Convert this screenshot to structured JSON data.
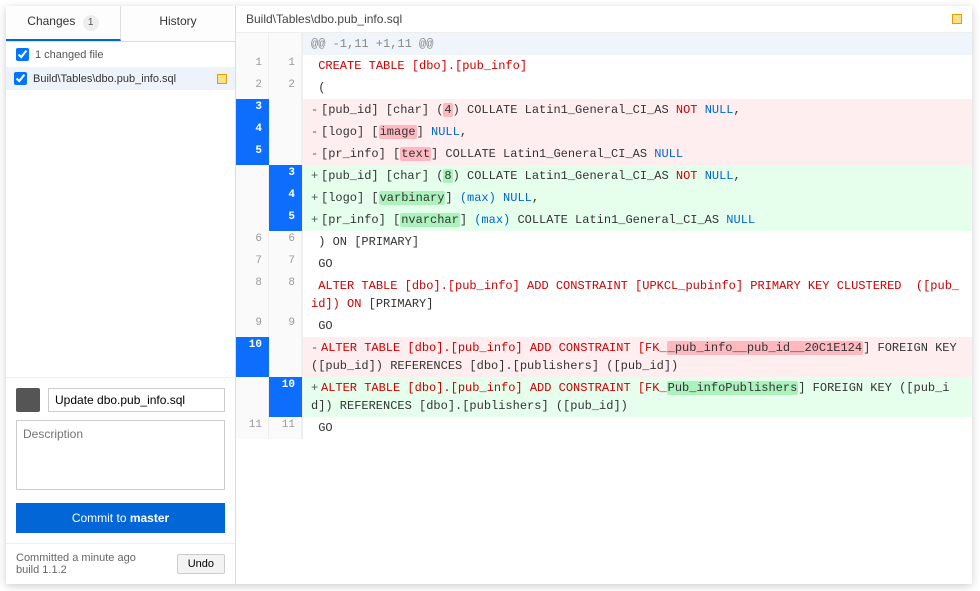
{
  "tabs": {
    "changes": "Changes",
    "changes_count": "1",
    "history": "History"
  },
  "file_header": "1 changed file",
  "files": [
    {
      "name": "Build\\Tables\\dbo.pub_info.sql"
    }
  ],
  "file_path": "Build\\Tables\\dbo.pub_info.sql",
  "commit": {
    "subject": "Update dbo.pub_info.sql",
    "desc_placeholder": "Description",
    "button_prefix": "Commit to ",
    "button_branch": "master",
    "committed_line1": "Committed a minute ago",
    "committed_line2": "build 1.1.2",
    "undo": "Undo"
  },
  "diff": {
    "hunk": "@@ -1,11 +1,11 @@",
    "l1": " CREATE TABLE [dbo].[pub_info]",
    "l2": " (",
    "l3_a": "[pub_id] [char] (",
    "l3_b": "4",
    "l3_c": ") COLLATE Latin1_General_CI_AS ",
    "l4_a": "[logo] [",
    "l4_b": "image",
    "l4_c": "] ",
    "l5_a": "[pr_info] [",
    "l5_b": "text",
    "l5_c": "] COLLATE Latin1_General_CI_AS ",
    "l3p_a": "[pub_id] [char] (",
    "l3p_b": "8",
    "l3p_c": ") COLLATE Latin1_General_CI_AS ",
    "l4p_a": "[logo] [",
    "l4p_b": "varbinary",
    "l4p_c": "] ",
    "l4p_d": "(max)",
    "l4p_e": " ",
    "l5p_a": "[pr_info] [",
    "l5p_b": "nvarchar",
    "l5p_c": "] ",
    "l5p_d": "(max)",
    "l5p_e": " COLLATE Latin1_General_CI_AS ",
    "l6": " ) ON [PRIMARY]",
    "l7": " GO",
    "l8a": " ALTER TABLE [dbo].[pub_info] ADD CONSTRAINT [UPKCL_pubinfo] PRIMARY KEY CLUSTERED  ([pub_id]) ",
    "l8b": "ON",
    "l8c": " [PRIMARY]",
    "l9": " GO",
    "l10m_a": "ALTER TABLE [dbo].[pub_info] ADD CONSTRAINT [FK_",
    "l10m_b": "_pub_info__pub_id__20C1E124",
    "l10m_c": "] FOREIGN KEY ([pub_id]) REFERENCES [dbo].[publishers] ([pub_id])",
    "l10p_a": "ALTER TABLE [dbo].[pub_info] ADD CONSTRAINT [FK_",
    "l10p_b": "Pub_infoPublishers",
    "l10p_c": "] FOREIGN KEY ([pub_id]) REFERENCES [dbo].[publishers] ([pub_id])",
    "l11": " GO",
    "not": "NOT",
    "null": "NULL",
    "old": {
      "3": "3",
      "4": "4",
      "5": "5",
      "6": "6",
      "7": "7",
      "8": "8",
      "9": "9",
      "10": "10",
      "11": "11",
      "1": "1",
      "2": "2"
    },
    "new": {
      "1": "1",
      "2": "2",
      "3": "3",
      "4": "4",
      "5": "5",
      "6": "6",
      "7": "7",
      "8": "8",
      "9": "9",
      "10": "10",
      "11": "11"
    }
  }
}
